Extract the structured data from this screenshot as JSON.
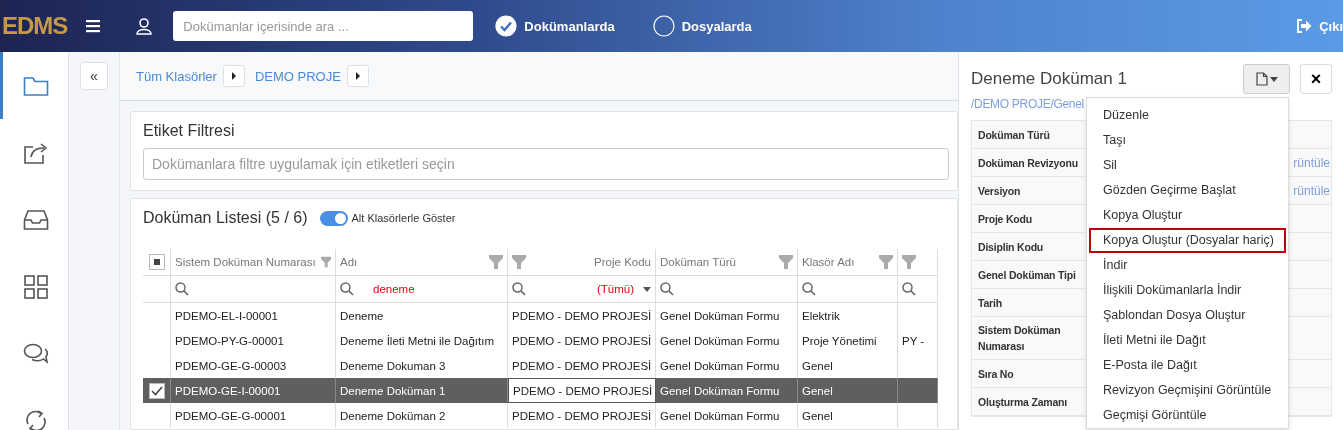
{
  "topbar": {
    "logo": "EDMS",
    "search": {
      "placeholder": "Dokümanlar içerisinde ara ..."
    },
    "scope": [
      {
        "label": "Dokümanlarda",
        "selected": true
      },
      {
        "label": "Dosyalarda",
        "selected": false
      }
    ],
    "logout": "Çıkı"
  },
  "sidebar": {
    "items": [
      {
        "kind": "folder",
        "selected": true
      },
      {
        "kind": "share",
        "selected": false
      },
      {
        "kind": "inbox",
        "selected": false
      },
      {
        "kind": "grid",
        "selected": false
      },
      {
        "kind": "chat",
        "selected": false
      },
      {
        "kind": "sync",
        "selected": false
      }
    ]
  },
  "collapse_button": "«",
  "breadcrumb": [
    "Tüm Klasörler",
    "DEMO PROJE"
  ],
  "tag_filter": {
    "title": "Etiket Filtresi",
    "placeholder": "Dokümanlara filtre uygulamak için etiketleri seçin"
  },
  "document_list": {
    "title": "Doküman Listesi (5 / 6)",
    "subfolders_toggle": {
      "label": "Alt Klasörlerle Göster",
      "on": true
    },
    "select_all": {
      "partially_checked": true
    },
    "columns": [
      {
        "label": "Sistem Doküman Numarası",
        "right_aligned": false,
        "focused": false,
        "filter": {
          "kind": "text"
        }
      },
      {
        "label": "Adı",
        "right_aligned": false,
        "focused": false,
        "filter": {
          "kind": "text",
          "value": "deneme"
        }
      },
      {
        "label": "Proje Kodu",
        "right_aligned": true,
        "focused": true,
        "filter": {
          "kind": "dropdown",
          "value": "(Tümü)"
        }
      },
      {
        "label": "Doküman Türü",
        "right_aligned": false,
        "focused": false,
        "filter": {
          "kind": "text"
        }
      },
      {
        "label": "Klasör Adı",
        "right_aligned": false,
        "focused": false,
        "filter": {
          "kind": "text"
        }
      },
      {
        "right_aligned": true,
        "focused": false,
        "filter": {
          "kind": "text"
        }
      }
    ],
    "rows": [
      {
        "selected": false,
        "cells": [
          "PDEMO-EL-I-00001",
          "Deneme",
          "PDEMO - DEMO PROJESİ",
          "Genel Doküman Formu",
          "Elektrik",
          ""
        ]
      },
      {
        "selected": false,
        "cells": [
          "PDEMO-PY-G-00001",
          "Deneme İleti Metni ile Dağıtım",
          "PDEMO - DEMO PROJESİ",
          "Genel Doküman Formu",
          "Proje Yönetimi",
          "PY -"
        ]
      },
      {
        "selected": false,
        "cells": [
          "PDEMO-GE-G-00003",
          "Deneme Dokuman 3",
          "PDEMO - DEMO PROJESİ",
          "Genel Doküman Formu",
          "Genel",
          ""
        ]
      },
      {
        "selected": true,
        "cells": [
          "PDEMO-GE-I-00001",
          "Deneme Doküman 1",
          "PDEMO - DEMO PROJESİ",
          "Genel Doküman Formu",
          "Genel",
          ""
        ]
      },
      {
        "selected": false,
        "cells": [
          "PDEMO-GE-G-00001",
          "Deneme Doküman 2",
          "PDEMO - DEMO PROJESİ",
          "Genel Doküman Formu",
          "Genel",
          ""
        ]
      }
    ]
  },
  "detail_panel": {
    "title": "Deneme Doküman 1",
    "path": "/DEMO PROJE/Genel",
    "properties": [
      {
        "label": "Doküman Türü"
      },
      {
        "label": "Doküman Revizyonu",
        "value": "rüntüle"
      },
      {
        "label": "Versiyon",
        "value": "rüntüle"
      },
      {
        "label": "Proje Kodu"
      },
      {
        "label": "Disiplin Kodu"
      },
      {
        "label": "Genel Doküman Tipi"
      },
      {
        "label": "Tarih"
      },
      {
        "label": "Sistem Doküman Numarası"
      },
      {
        "label": "Sıra No"
      },
      {
        "label": "Oluşturma Zamanı"
      }
    ],
    "close_button": "×",
    "actions_menu": [
      {
        "label": "Düzenle",
        "selected": false
      },
      {
        "label": "Taşı",
        "selected": false
      },
      {
        "label": "Sil",
        "selected": false
      },
      {
        "label": "Gözden Geçirme Başlat",
        "selected": false
      },
      {
        "label": "Kopya Oluştur",
        "selected": false
      },
      {
        "label": "Kopya Oluştur (Dosyalar hariç)",
        "selected": true
      },
      {
        "label": "İndir",
        "selected": false
      },
      {
        "label": "İlişkili Dokümanlarla İndir",
        "selected": false
      },
      {
        "label": "Şablondan Dosya Oluştur",
        "selected": false
      },
      {
        "label": "İleti Metni ile Dağıt",
        "selected": false
      },
      {
        "label": "E-Posta ile Dağıt",
        "selected": false
      },
      {
        "label": "Revizyon Geçmişini Görüntüle",
        "selected": false
      },
      {
        "label": "Geçmişi Görüntüle",
        "selected": false
      }
    ]
  }
}
